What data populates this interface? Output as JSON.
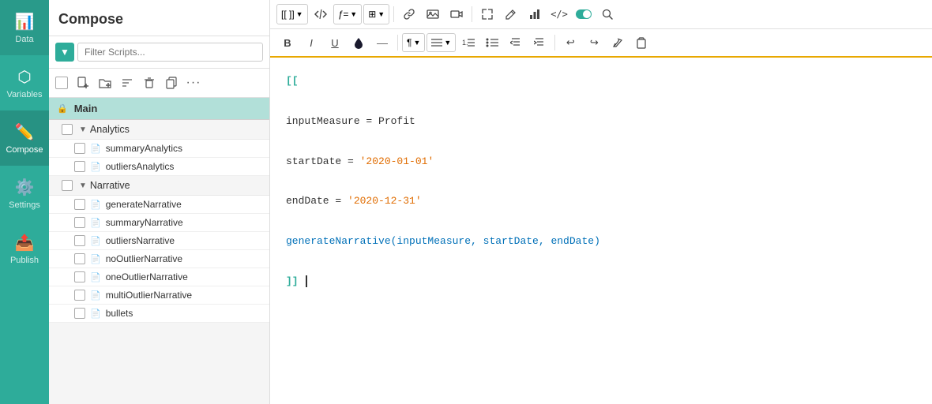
{
  "app": {
    "title": "Compose"
  },
  "nav": {
    "items": [
      {
        "id": "data",
        "label": "Data",
        "icon": "📊",
        "active": false
      },
      {
        "id": "variables",
        "label": "Variables",
        "icon": "⬡",
        "active": false
      },
      {
        "id": "compose",
        "label": "Compose",
        "icon": "✏️",
        "active": true
      },
      {
        "id": "settings",
        "label": "Settings",
        "icon": "⚙️",
        "active": false
      },
      {
        "id": "publish",
        "label": "Publish",
        "icon": "📤",
        "active": false
      }
    ]
  },
  "sidebar": {
    "title": "Compose",
    "search_placeholder": "Filter Scripts...",
    "toolbar_buttons": [
      "add-file",
      "add-folder",
      "sort",
      "delete",
      "copy",
      "more"
    ],
    "tree": {
      "main_label": "Main",
      "groups": [
        {
          "label": "Analytics",
          "items": [
            "summaryAnalytics",
            "outliersAnalytics"
          ]
        },
        {
          "label": "Narrative",
          "items": [
            "generateNarrative",
            "summaryNarrative",
            "outliersNarrative",
            "noOutlierNarrative",
            "oneOutlierNarrative",
            "multiOutlierNarrative",
            "bullets"
          ]
        }
      ]
    }
  },
  "editor": {
    "toolbar_top": {
      "buttons": [
        {
          "id": "brackets",
          "label": "[["
        },
        {
          "id": "script",
          "label": "⎇"
        },
        {
          "id": "function",
          "label": "ƒ="
        },
        {
          "id": "component",
          "label": "⊞"
        },
        {
          "id": "link",
          "label": "🔗"
        },
        {
          "id": "image",
          "label": "🖼"
        },
        {
          "id": "video",
          "label": "📹"
        },
        {
          "id": "expand",
          "label": "⤢"
        },
        {
          "id": "edit",
          "label": "✎"
        },
        {
          "id": "chart",
          "label": "📈"
        },
        {
          "id": "code",
          "label": "</>"
        },
        {
          "id": "toggle",
          "label": "◑"
        },
        {
          "id": "search",
          "label": "🔍"
        }
      ]
    },
    "toolbar_format": {
      "buttons": [
        {
          "id": "bold",
          "label": "B"
        },
        {
          "id": "italic",
          "label": "I"
        },
        {
          "id": "underline",
          "label": "U"
        },
        {
          "id": "ink",
          "label": "💧"
        },
        {
          "id": "hr",
          "label": "—"
        },
        {
          "id": "paragraph",
          "label": "¶"
        },
        {
          "id": "align",
          "label": "≡"
        },
        {
          "id": "ol",
          "label": "1."
        },
        {
          "id": "ul",
          "label": "•"
        },
        {
          "id": "indent-dec",
          "label": "⇤"
        },
        {
          "id": "indent-inc",
          "label": "⇥"
        },
        {
          "id": "undo",
          "label": "↩"
        },
        {
          "id": "redo",
          "label": "↪"
        },
        {
          "id": "format-clear",
          "label": "🪣"
        },
        {
          "id": "paste",
          "label": "📋"
        }
      ]
    },
    "code": {
      "line1": "[[",
      "line2": "",
      "line3": "inputMeasure = Profit",
      "line4": "",
      "line5": "startDate = '2020-01-01'",
      "line6": "",
      "line7": "endDate = '2020-12-31'",
      "line8": "",
      "line9": "generateNarrative(inputMeasure, startDate, endDate)",
      "line10": "",
      "line11": "]]"
    }
  }
}
